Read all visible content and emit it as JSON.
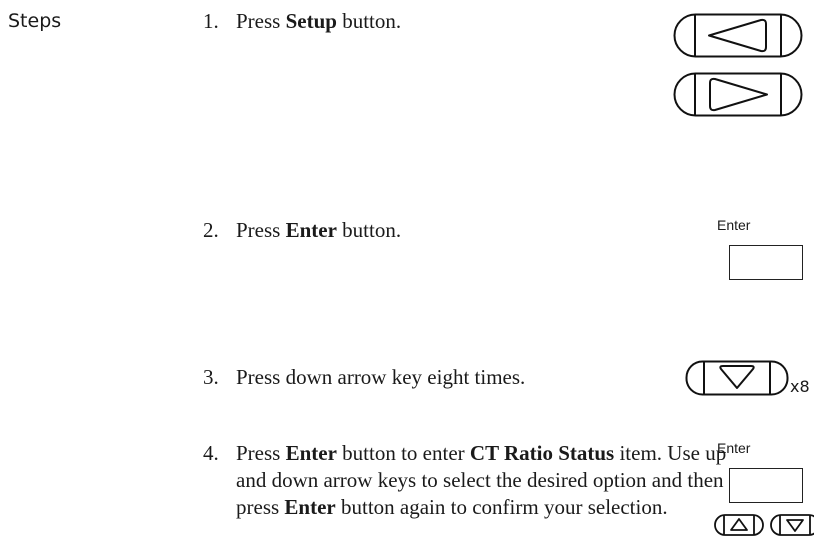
{
  "section_label": "Steps",
  "steps": [
    {
      "num": "1.",
      "parts": [
        {
          "t": "Press "
        },
        {
          "t": "Setup",
          "b": true
        },
        {
          "t": " button."
        }
      ]
    },
    {
      "num": "2.",
      "parts": [
        {
          "t": "Press "
        },
        {
          "t": "Enter",
          "b": true
        },
        {
          "t": " button."
        }
      ]
    },
    {
      "num": "3.",
      "parts": [
        {
          "t": "Press down arrow key eight times."
        }
      ]
    },
    {
      "num": "4.",
      "parts": [
        {
          "t": "Press "
        },
        {
          "t": "Enter",
          "b": true
        },
        {
          "t": " button to enter "
        },
        {
          "t": "CT Ratio Status",
          "b": true
        },
        {
          "t": " item. Use up and down arrow keys to select the desired option and then press "
        },
        {
          "t": "Enter",
          "b": true
        },
        {
          "t": " button again to confirm your selection."
        }
      ]
    }
  ],
  "keys": {
    "enter_label": "Enter",
    "repeat_label": "x8"
  }
}
